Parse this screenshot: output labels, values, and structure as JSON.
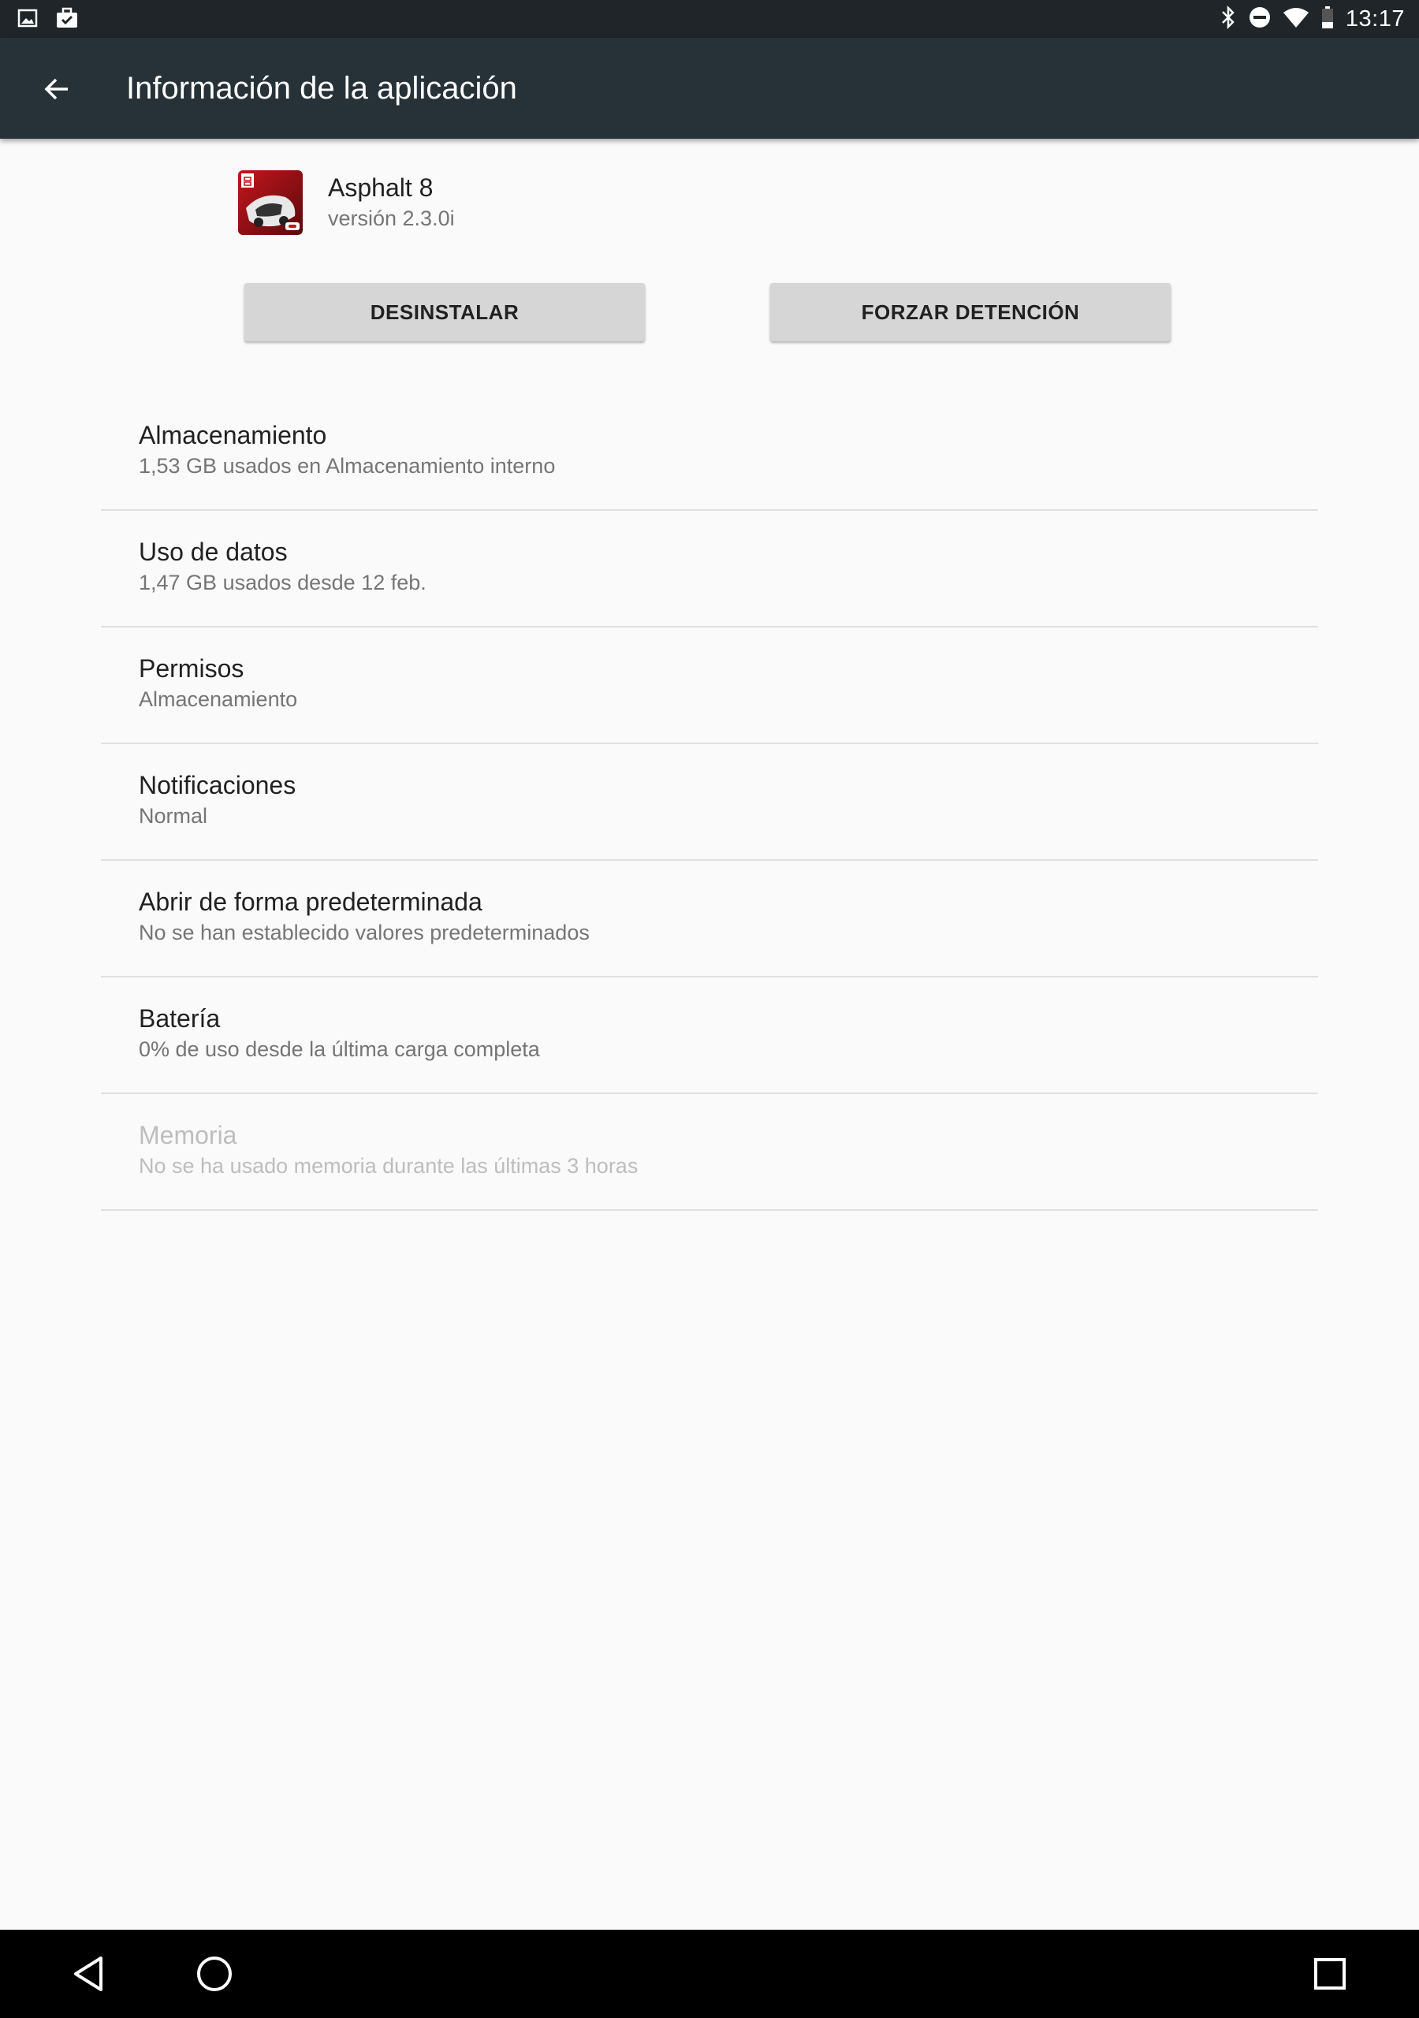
{
  "status_bar": {
    "time": "13:17",
    "left_icons": [
      "image-icon",
      "briefcase-check-icon"
    ],
    "right_icons": [
      "bluetooth-icon",
      "do-not-disturb-icon",
      "wifi-icon",
      "battery-icon"
    ]
  },
  "toolbar": {
    "title": "Información de la aplicación",
    "background": "#263238"
  },
  "app": {
    "name": "Asphalt 8",
    "version": "versión 2.3.0i"
  },
  "buttons": {
    "uninstall": "DESINSTALAR",
    "force_stop": "FORZAR DETENCIÓN"
  },
  "settings": [
    {
      "title": "Almacenamiento",
      "subtitle": "1,53 GB usados en Almacenamiento interno",
      "enabled": true
    },
    {
      "title": "Uso de datos",
      "subtitle": "1,47 GB usados desde 12 feb.",
      "enabled": true
    },
    {
      "title": "Permisos",
      "subtitle": "Almacenamiento",
      "enabled": true
    },
    {
      "title": "Notificaciones",
      "subtitle": "Normal",
      "enabled": true
    },
    {
      "title": "Abrir de forma predeterminada",
      "subtitle": "No se han establecido valores predeterminados",
      "enabled": true
    },
    {
      "title": "Batería",
      "subtitle": "0% de uso desde la última carga completa",
      "enabled": true
    },
    {
      "title": "Memoria",
      "subtitle": "No se ha usado memoria durante las últimas 3 horas",
      "enabled": false
    }
  ],
  "nav_bar": {
    "icons": [
      "back-triangle-icon",
      "home-circle-icon",
      "recents-square-icon"
    ]
  }
}
